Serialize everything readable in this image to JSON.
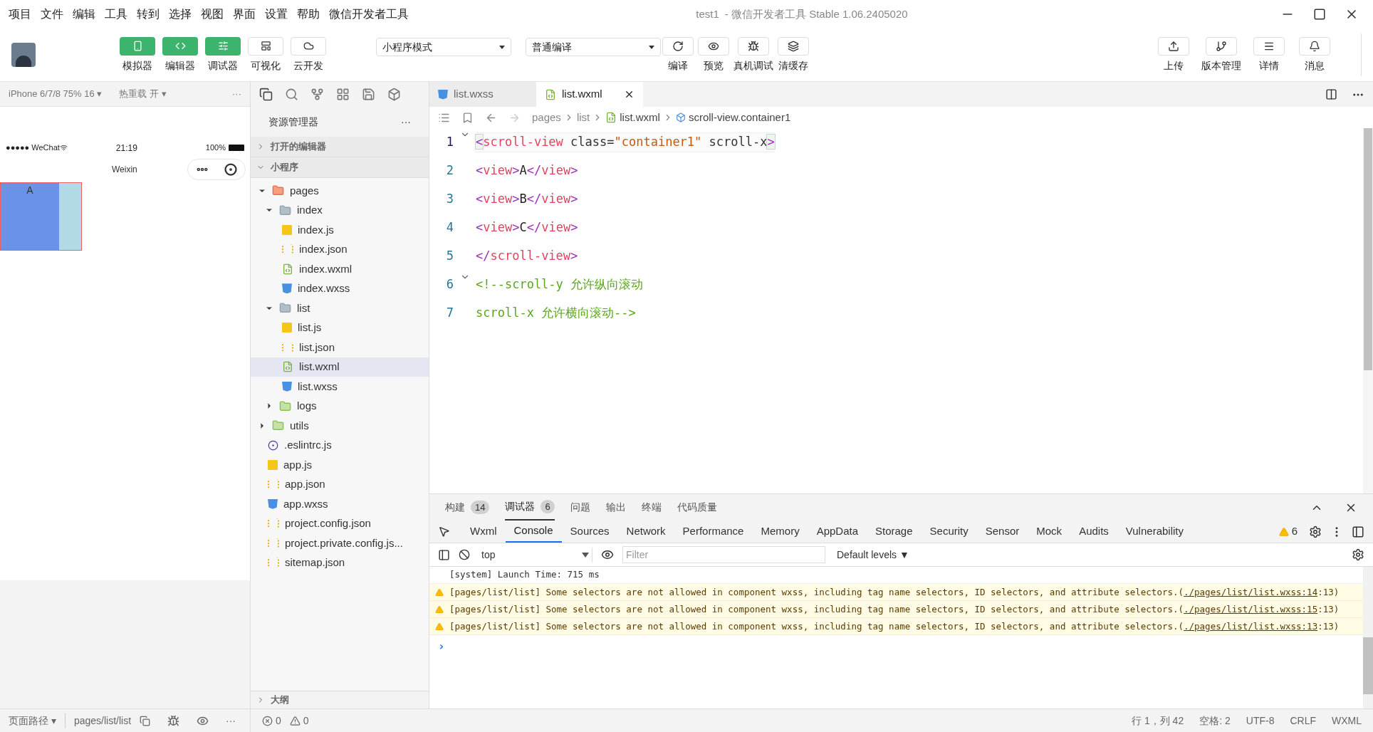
{
  "menu": [
    "项目",
    "文件",
    "编辑",
    "工具",
    "转到",
    "选择",
    "视图",
    "界面",
    "设置",
    "帮助",
    "微信开发者工具"
  ],
  "window": {
    "title": "test1",
    "subtitle": "- 微信开发者工具 Stable 1.06.2405020"
  },
  "toolbar": {
    "toggles": [
      {
        "label": "模拟器",
        "kind": "phone",
        "on": true
      },
      {
        "label": "编辑器",
        "kind": "code",
        "on": true
      },
      {
        "label": "调试器",
        "kind": "sliders",
        "on": true
      },
      {
        "label": "可视化",
        "kind": "layout",
        "on": false
      },
      {
        "label": "云开发",
        "kind": "cloud",
        "on": false
      }
    ],
    "mode": "小程序模式",
    "compile": "普通编译",
    "actions": [
      {
        "label": "编译",
        "kind": "refresh"
      },
      {
        "label": "预览",
        "kind": "eye"
      },
      {
        "label": "真机调试",
        "kind": "bug"
      },
      {
        "label": "清缓存",
        "kind": "layers"
      }
    ],
    "right": [
      {
        "label": "上传",
        "kind": "upload"
      },
      {
        "label": "版本管理",
        "kind": "branch"
      },
      {
        "label": "详情",
        "kind": "menu"
      },
      {
        "label": "消息",
        "kind": "bell"
      }
    ]
  },
  "simulator": {
    "device": "iPhone 6/7/8 75% 16 ▾",
    "hot_reload": "热重载 开 ▾",
    "more": "···",
    "carrier": "●●●●● WeChat",
    "time": "21:19",
    "battery": "100%",
    "nav_title": "Weixin",
    "items": [
      "A"
    ],
    "path_label": "页面路径 ▾",
    "path": "pages/list/list",
    "more2": "···"
  },
  "explorer": {
    "title": "资源管理器",
    "more": "···",
    "sections": [
      {
        "label": "打开的编辑器",
        "expanded": false
      },
      {
        "label": "小程序",
        "expanded": true
      }
    ],
    "tree": [
      {
        "name": "pages",
        "kind": "folder-pages",
        "expanded": true,
        "selected": false,
        "children": [
          {
            "name": "index",
            "kind": "folder",
            "expanded": true,
            "selected": false,
            "children": [
              {
                "name": "index.js",
                "kind": "js",
                "selected": false
              },
              {
                "name": "index.json",
                "kind": "json",
                "selected": false
              },
              {
                "name": "index.wxml",
                "kind": "wxml",
                "selected": false
              },
              {
                "name": "index.wxss",
                "kind": "wxss",
                "selected": false
              }
            ]
          },
          {
            "name": "list",
            "kind": "folder",
            "expanded": true,
            "selected": false,
            "children": [
              {
                "name": "list.js",
                "kind": "js",
                "selected": false
              },
              {
                "name": "list.json",
                "kind": "json",
                "selected": false
              },
              {
                "name": "list.wxml",
                "kind": "wxml",
                "selected": true
              },
              {
                "name": "list.wxss",
                "kind": "wxss",
                "selected": false
              }
            ]
          },
          {
            "name": "logs",
            "kind": "folder-green",
            "expanded": false,
            "selected": false
          }
        ]
      },
      {
        "name": "utils",
        "kind": "folder-green",
        "expanded": false,
        "selected": false
      },
      {
        "name": ".eslintrc.js",
        "kind": "eslint",
        "selected": false
      },
      {
        "name": "app.js",
        "kind": "js",
        "selected": false
      },
      {
        "name": "app.json",
        "kind": "json",
        "selected": false
      },
      {
        "name": "app.wxss",
        "kind": "wxss",
        "selected": false
      },
      {
        "name": "project.config.json",
        "kind": "json",
        "selected": false
      },
      {
        "name": "project.private.config.js...",
        "kind": "json",
        "selected": false
      },
      {
        "name": "sitemap.json",
        "kind": "json",
        "selected": false
      }
    ],
    "outline": "大纲",
    "errors": "0",
    "warnings": "0"
  },
  "editor": {
    "tabs": [
      {
        "label": "list.wxss",
        "kind": "wxss",
        "selected": false
      },
      {
        "label": "list.wxml",
        "kind": "wxml",
        "selected": true
      }
    ],
    "breadcrumb": [
      "pages",
      "list",
      "list.wxml",
      "scroll-view.container1"
    ],
    "lines": [
      {
        "number": "1",
        "foldable": true,
        "tokens": [
          {
            "kind": "bracket",
            "text": "<"
          },
          {
            "kind": "tag",
            "text": "scroll-view"
          },
          {
            "kind": "attr",
            "text": " class="
          },
          {
            "kind": "string",
            "text": "\"container1\""
          },
          {
            "kind": "attr",
            "text": " scroll-x"
          },
          {
            "kind": "bracket",
            "text": ">"
          }
        ]
      },
      {
        "number": "2",
        "foldable": false,
        "tokens": [
          {
            "kind": "punct",
            "text": "<"
          },
          {
            "kind": "tag",
            "text": "view"
          },
          {
            "kind": "punct",
            "text": ">"
          },
          {
            "kind": "text",
            "text": "A"
          },
          {
            "kind": "punct",
            "text": "</"
          },
          {
            "kind": "tag",
            "text": "view"
          },
          {
            "kind": "punct",
            "text": ">"
          }
        ]
      },
      {
        "number": "3",
        "foldable": false,
        "tokens": [
          {
            "kind": "punct",
            "text": "<"
          },
          {
            "kind": "tag",
            "text": "view"
          },
          {
            "kind": "punct",
            "text": ">"
          },
          {
            "kind": "text",
            "text": "B"
          },
          {
            "kind": "punct",
            "text": "</"
          },
          {
            "kind": "tag",
            "text": "view"
          },
          {
            "kind": "punct",
            "text": ">"
          }
        ]
      },
      {
        "number": "4",
        "foldable": false,
        "tokens": [
          {
            "kind": "punct",
            "text": "<"
          },
          {
            "kind": "tag",
            "text": "view"
          },
          {
            "kind": "punct",
            "text": ">"
          },
          {
            "kind": "text",
            "text": "C"
          },
          {
            "kind": "punct",
            "text": "</"
          },
          {
            "kind": "tag",
            "text": "view"
          },
          {
            "kind": "punct",
            "text": ">"
          }
        ]
      },
      {
        "number": "5",
        "foldable": false,
        "tokens": [
          {
            "kind": "punct",
            "text": "</"
          },
          {
            "kind": "tag",
            "text": "scroll-view"
          },
          {
            "kind": "punct",
            "text": ">"
          }
        ]
      },
      {
        "number": "6",
        "foldable": true,
        "tokens": [
          {
            "kind": "comment",
            "text": "<!--scroll-y 允许纵向滚动"
          }
        ]
      },
      {
        "number": "7",
        "foldable": false,
        "tokens": [
          {
            "kind": "comment",
            "text": "scroll-x 允许横向滚动-->"
          }
        ]
      }
    ]
  },
  "panel": {
    "tabs": [
      {
        "label": "构建",
        "count": "14",
        "selected": false
      },
      {
        "label": "调试器",
        "count": "6",
        "selected": true
      },
      {
        "label": "问题",
        "selected": false
      },
      {
        "label": "输出",
        "selected": false
      },
      {
        "label": "终端",
        "selected": false
      },
      {
        "label": "代码质量",
        "selected": false
      }
    ],
    "devtools_tabs": [
      {
        "label": "Wxml",
        "selected": false
      },
      {
        "label": "Console",
        "selected": true
      },
      {
        "label": "Sources",
        "selected": false
      },
      {
        "label": "Network",
        "selected": false
      },
      {
        "label": "Performance",
        "selected": false
      },
      {
        "label": "Memory",
        "selected": false
      },
      {
        "label": "AppData",
        "selected": false
      },
      {
        "label": "Storage",
        "selected": false
      },
      {
        "label": "Security",
        "selected": false
      },
      {
        "label": "Sensor",
        "selected": false
      },
      {
        "label": "Mock",
        "selected": false
      },
      {
        "label": "Audits",
        "selected": false
      },
      {
        "label": "Vulnerability",
        "selected": false
      }
    ],
    "warning_count": "6",
    "context": "top",
    "filter_placeholder": "Filter",
    "levels": "Default levels ▼",
    "messages": [
      {
        "kind": "system",
        "text": "[system] Launch Time: 715 ms"
      },
      {
        "kind": "warning",
        "text": "[pages/list/list] Some selectors are not allowed in component wxss, including tag name selectors, ID selectors, and attribute selectors.(",
        "link": "./pages/list/list.wxss:14",
        "suffix": ":13)"
      },
      {
        "kind": "warning",
        "text": "[pages/list/list] Some selectors are not allowed in component wxss, including tag name selectors, ID selectors, and attribute selectors.(",
        "link": "./pages/list/list.wxss:15",
        "suffix": ":13)"
      },
      {
        "kind": "warning",
        "text": "[pages/list/list] Some selectors are not allowed in component wxss, including tag name selectors, ID selectors, and attribute selectors.(",
        "link": "./pages/list/list.wxss:13",
        "suffix": ":13)"
      }
    ],
    "prompt": "›"
  },
  "status": [
    "行 1，列 42",
    "空格: 2",
    "UTF-8",
    "CRLF",
    "WXML"
  ]
}
